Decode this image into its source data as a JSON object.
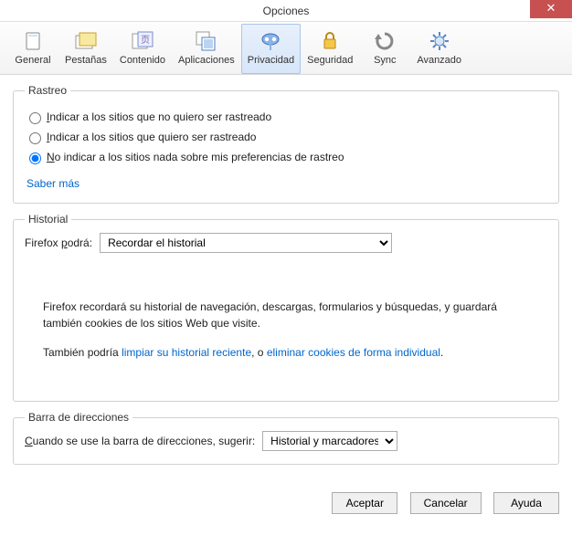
{
  "title": "Opciones",
  "close_glyph": "✕",
  "toolbar": {
    "items": [
      {
        "key": "general",
        "label": "General"
      },
      {
        "key": "pestanas",
        "label": "Pestañas"
      },
      {
        "key": "contenido",
        "label": "Contenido"
      },
      {
        "key": "aplicaciones",
        "label": "Aplicaciones"
      },
      {
        "key": "privacidad",
        "label": "Privacidad"
      },
      {
        "key": "seguridad",
        "label": "Seguridad"
      },
      {
        "key": "sync",
        "label": "Sync"
      },
      {
        "key": "avanzado",
        "label": "Avanzado"
      }
    ],
    "active": "privacidad"
  },
  "tracking": {
    "legend": "Rastreo",
    "opt1": "ndicar a los sitios que no quiero ser rastreado",
    "opt1_accel": "I",
    "opt2": "ndicar a los sitios que quiero ser rastreado",
    "opt2_accel": "I",
    "opt3_accel": "N",
    "opt3": "o indicar a los sitios nada sobre mis preferencias de rastreo",
    "selected": 3,
    "more": "Saber más"
  },
  "history": {
    "legend": "Historial",
    "label_pre": "Firefox ",
    "label_accel": "p",
    "label_post": "odrá:",
    "select_value": "Recordar el historial",
    "body1": "Firefox recordará su historial de navegación, descargas, formularios y búsquedas, y guardará también cookies de los sitios Web que visite.",
    "body2_pre": "También podría ",
    "body2_link1": "limpiar su historial reciente",
    "body2_mid": ", o ",
    "body2_link2": "eliminar cookies de forma individual",
    "body2_post": "."
  },
  "addressbar": {
    "legend": "Barra de direcciones",
    "label_accel": "C",
    "label": "uando se use la barra de direcciones, sugerir:",
    "select_value": "Historial y marcadores"
  },
  "buttons": {
    "ok": "Aceptar",
    "cancel": "Cancelar",
    "help": "Ayuda"
  }
}
